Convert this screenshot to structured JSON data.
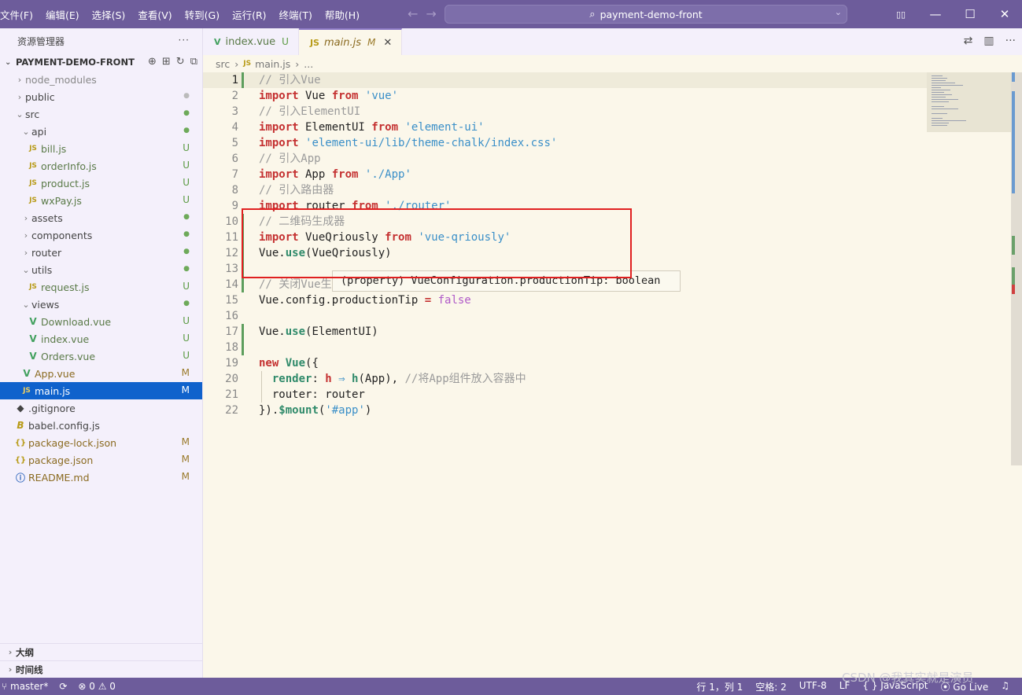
{
  "titlebar": {
    "menus": [
      "文件(F)",
      "编辑(E)",
      "选择(S)",
      "查看(V)",
      "转到(G)",
      "运行(R)",
      "终端(T)",
      "帮助(H)"
    ],
    "search_text": "payment-demo-front",
    "back_icon": "←",
    "forward_icon": "→",
    "min": "—",
    "max": "☐",
    "close": "✕",
    "layout_icon": "▯▯"
  },
  "sidebar": {
    "title": "资源管理器",
    "more": "···",
    "project": "PAYMENT-DEMO-FRONT",
    "tree": [
      {
        "depth": 0,
        "chev": "›",
        "icon": "",
        "name": "node_modules",
        "status": "",
        "style": "gray"
      },
      {
        "depth": 0,
        "chev": "›",
        "icon": "",
        "name": "public",
        "status": "●",
        "style": "normal",
        "status_style": "dot-gray"
      },
      {
        "depth": 0,
        "chev": "⌄",
        "icon": "",
        "name": "src",
        "status": "●",
        "style": "normal",
        "status_style": "dot-green"
      },
      {
        "depth": 1,
        "chev": "⌄",
        "icon": "",
        "name": "api",
        "status": "●",
        "style": "normal",
        "status_style": "dot-green"
      },
      {
        "depth": 2,
        "chev": "",
        "icon": "JS",
        "name": "bill.js",
        "status": "U",
        "style": "u"
      },
      {
        "depth": 2,
        "chev": "",
        "icon": "JS",
        "name": "orderInfo.js",
        "status": "U",
        "style": "u"
      },
      {
        "depth": 2,
        "chev": "",
        "icon": "JS",
        "name": "product.js",
        "status": "U",
        "style": "u"
      },
      {
        "depth": 2,
        "chev": "",
        "icon": "JS",
        "name": "wxPay.js",
        "status": "U",
        "style": "u"
      },
      {
        "depth": 1,
        "chev": "›",
        "icon": "",
        "name": "assets",
        "status": "●",
        "style": "normal",
        "status_style": "dot-green"
      },
      {
        "depth": 1,
        "chev": "›",
        "icon": "",
        "name": "components",
        "status": "●",
        "style": "normal",
        "status_style": "dot-green"
      },
      {
        "depth": 1,
        "chev": "›",
        "icon": "",
        "name": "router",
        "status": "●",
        "style": "normal",
        "status_style": "dot-green"
      },
      {
        "depth": 1,
        "chev": "⌄",
        "icon": "",
        "name": "utils",
        "status": "●",
        "style": "normal",
        "status_style": "dot-green"
      },
      {
        "depth": 2,
        "chev": "",
        "icon": "JS",
        "name": "request.js",
        "status": "U",
        "style": "u"
      },
      {
        "depth": 1,
        "chev": "⌄",
        "icon": "",
        "name": "views",
        "status": "●",
        "style": "normal",
        "status_style": "dot-green"
      },
      {
        "depth": 2,
        "chev": "",
        "icon": "V",
        "name": "Download.vue",
        "status": "U",
        "style": "u"
      },
      {
        "depth": 2,
        "chev": "",
        "icon": "V",
        "name": "index.vue",
        "status": "U",
        "style": "u"
      },
      {
        "depth": 2,
        "chev": "",
        "icon": "V",
        "name": "Orders.vue",
        "status": "U",
        "style": "u"
      },
      {
        "depth": 1,
        "chev": "",
        "icon": "V",
        "name": "App.vue",
        "status": "M",
        "style": "m"
      },
      {
        "depth": 1,
        "chev": "",
        "icon": "JS",
        "name": "main.js",
        "status": "M",
        "style": "selected"
      },
      {
        "depth": 0,
        "chev": "",
        "icon": "◆",
        "name": ".gitignore",
        "status": "",
        "style": "normal"
      },
      {
        "depth": 0,
        "chev": "",
        "icon": "B",
        "name": "babel.config.js",
        "status": "",
        "style": "normal"
      },
      {
        "depth": 0,
        "chev": "",
        "icon": "{}",
        "name": "package-lock.json",
        "status": "M",
        "style": "m"
      },
      {
        "depth": 0,
        "chev": "",
        "icon": "{}",
        "name": "package.json",
        "status": "M",
        "style": "m"
      },
      {
        "depth": 0,
        "chev": "",
        "icon": "ⓘ",
        "name": "README.md",
        "status": "M",
        "style": "m"
      }
    ],
    "outline": "大纲",
    "timeline": "时间线"
  },
  "tabs": [
    {
      "icon": "V",
      "name": "index.vue",
      "status": "U",
      "active": false
    },
    {
      "icon": "JS",
      "name": "main.js",
      "status": "M",
      "active": true,
      "close": "✕"
    }
  ],
  "breadcrumb": {
    "folder": "src",
    "file_icon": "JS",
    "file": "main.js",
    "rest": "..."
  },
  "editor": {
    "lines": [
      [
        [
          "c-comment",
          "// 引入Vue"
        ]
      ],
      [
        [
          "c-kw",
          "import"
        ],
        [
          "",
          " Vue "
        ],
        [
          "c-kw",
          "from"
        ],
        [
          "",
          " "
        ],
        [
          "c-str",
          "'vue'"
        ]
      ],
      [
        [
          "c-comment",
          "// 引入ElementUI"
        ]
      ],
      [
        [
          "c-kw",
          "import"
        ],
        [
          "",
          " ElementUI "
        ],
        [
          "c-kw",
          "from"
        ],
        [
          "",
          " "
        ],
        [
          "c-str",
          "'element-ui'"
        ]
      ],
      [
        [
          "c-kw",
          "import"
        ],
        [
          "",
          " "
        ],
        [
          "c-str",
          "'element-ui/lib/theme-chalk/index.css'"
        ]
      ],
      [
        [
          "c-comment",
          "// 引入App"
        ]
      ],
      [
        [
          "c-kw",
          "import"
        ],
        [
          "",
          " App "
        ],
        [
          "c-kw",
          "from"
        ],
        [
          "",
          " "
        ],
        [
          "c-str",
          "'./App'"
        ]
      ],
      [
        [
          "c-comment",
          "// 引入路由器"
        ]
      ],
      [
        [
          "c-kw",
          "import"
        ],
        [
          "",
          " router "
        ],
        [
          "c-kw",
          "from"
        ],
        [
          "",
          " "
        ],
        [
          "c-str",
          "'./router'"
        ]
      ],
      [
        [
          "c-comment",
          "// 二维码生成器"
        ]
      ],
      [
        [
          "c-kw",
          "import"
        ],
        [
          "",
          " VueQriously "
        ],
        [
          "c-kw",
          "from"
        ],
        [
          "",
          " "
        ],
        [
          "c-str",
          "'vue-qriously'"
        ]
      ],
      [
        [
          "",
          "Vue."
        ],
        [
          "c-fn",
          "use"
        ],
        [
          "",
          "(VueQriously)"
        ]
      ],
      [],
      [
        [
          "c-comment",
          "// 关闭Vue生"
        ]
      ],
      [
        [
          "",
          "Vue.config.productionTip "
        ],
        [
          "c-kw",
          "="
        ],
        [
          "",
          " "
        ],
        [
          "c-bool",
          "false"
        ]
      ],
      [],
      [
        [
          "",
          "Vue."
        ],
        [
          "c-fn",
          "use"
        ],
        [
          "",
          "(ElementUI)"
        ]
      ],
      [],
      [
        [
          "c-kw",
          "new"
        ],
        [
          "",
          " "
        ],
        [
          "c-fn",
          "Vue"
        ],
        [
          "",
          "({"
        ]
      ],
      [
        [
          "",
          "  "
        ],
        [
          "c-fn",
          "render"
        ],
        [
          "",
          ": "
        ],
        [
          "c-kw",
          "h"
        ],
        [
          "",
          " "
        ],
        [
          "c-arrow",
          "⇒"
        ],
        [
          "",
          " "
        ],
        [
          "c-fn",
          "h"
        ],
        [
          "",
          "(App), "
        ],
        [
          "c-comment",
          "//将App组件放入容器中"
        ]
      ],
      [
        [
          "",
          "  router: router"
        ]
      ],
      [
        [
          "",
          "})."
        ],
        [
          "c-fn",
          "$mount"
        ],
        [
          "",
          "("
        ],
        [
          "c-str",
          "'#app'"
        ],
        [
          "",
          ")"
        ]
      ]
    ],
    "hover_text": "(property) VueConfiguration.productionTip: boolean"
  },
  "statusbar": {
    "branch": "master*",
    "sync": "⟳",
    "problems": "⊗ 0 ⚠ 0",
    "position": "行 1，列 1",
    "spaces": "空格: 2",
    "encoding": "UTF-8",
    "eol": "LF",
    "language": "{ } JavaScript",
    "golive": "Go Live"
  },
  "watermark": "CSDN @我其实就是演员"
}
